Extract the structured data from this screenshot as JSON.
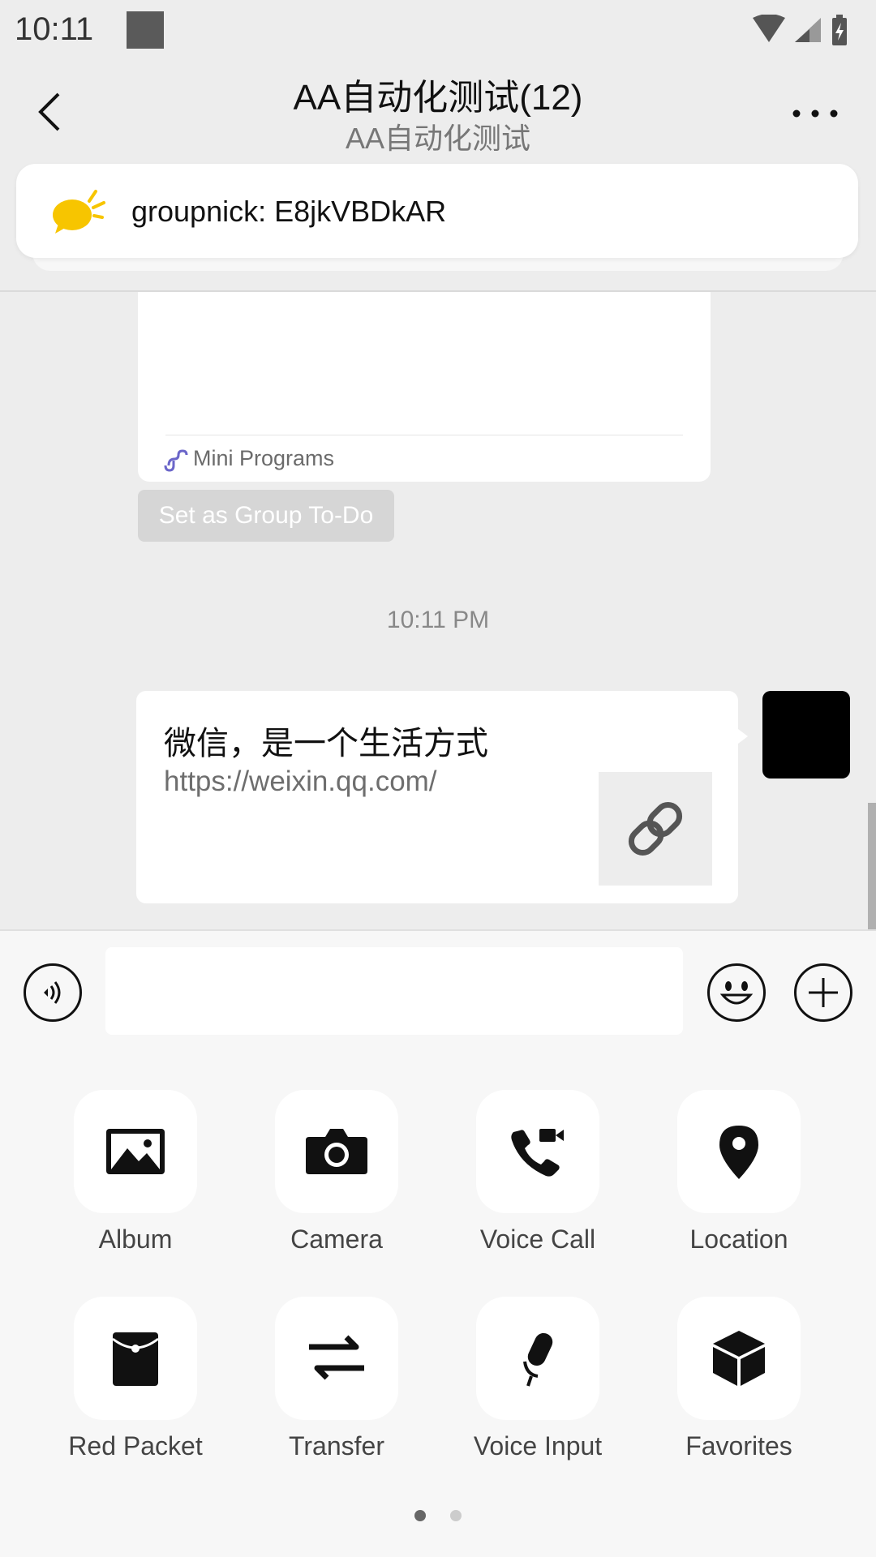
{
  "status_bar": {
    "time": "10:11"
  },
  "header": {
    "title": "AA自动化测试(12)",
    "subtitle": "AA自动化测试"
  },
  "pinned": {
    "text": "groupnick: E8jkVBDkAR"
  },
  "chat": {
    "mini_program_label": "Mini Programs",
    "todo_button": "Set as Group To-Do",
    "timestamp": "10:11 PM",
    "message": {
      "title": "微信，是一个生活方式",
      "url": "https://weixin.qq.com/"
    }
  },
  "panel": {
    "items": [
      {
        "label": "Album",
        "icon": "image-icon"
      },
      {
        "label": "Camera",
        "icon": "camera-icon"
      },
      {
        "label": "Voice Call",
        "icon": "phone-video-icon"
      },
      {
        "label": "Location",
        "icon": "location-pin-icon"
      },
      {
        "label": "Red Packet",
        "icon": "red-packet-icon"
      },
      {
        "label": "Transfer",
        "icon": "transfer-arrows-icon"
      },
      {
        "label": "Voice Input",
        "icon": "microphone-icon"
      },
      {
        "label": "Favorites",
        "icon": "cube-icon"
      }
    ],
    "page_count": 2,
    "active_page": 1
  }
}
